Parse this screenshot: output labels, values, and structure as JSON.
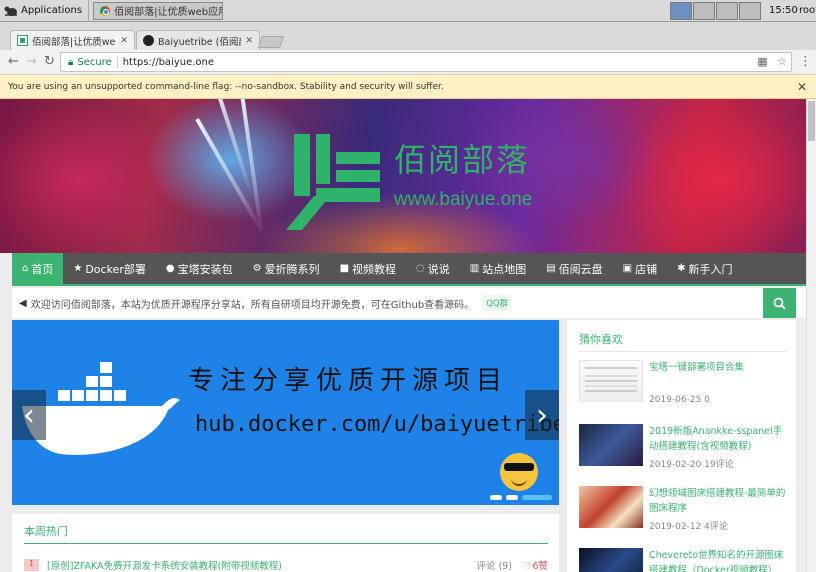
{
  "taskbar": {
    "apps_label": "Applications",
    "task_label": "佰阅部落|让优质web应用脱…",
    "clock": "15:50",
    "user": "root"
  },
  "browser": {
    "tabs": [
      {
        "title": "佰阅部落|让优质web应用脱…",
        "active": true
      },
      {
        "title": "Baiyuetribe (佰阅部落)",
        "active": false
      }
    ],
    "secure_label": "Secure",
    "url": "https://baiyue.one",
    "infobar": "You are using an unsupported command-line flag: --no-sandbox. Stability and security will suffer."
  },
  "site": {
    "logo_title": "佰阅部落",
    "logo_sub": "www.baiyue.one",
    "nav": [
      {
        "label": "首页",
        "icon": "home-icon",
        "glyph": "⌂",
        "active": true
      },
      {
        "label": "Docker部署",
        "icon": "star-icon",
        "glyph": "★",
        "active": false
      },
      {
        "label": "宝塔安装包",
        "icon": "comment-icon",
        "glyph": "●",
        "active": false
      },
      {
        "label": "爱折腾系列",
        "icon": "cogs-icon",
        "glyph": "⚙",
        "active": false
      },
      {
        "label": "视频教程",
        "icon": "video-icon",
        "glyph": "■",
        "active": false
      },
      {
        "label": "说说",
        "icon": "chat-icon",
        "glyph": "◌",
        "active": false
      },
      {
        "label": "站点地图",
        "icon": "map-icon",
        "glyph": "▥",
        "active": false
      },
      {
        "label": "佰阅云盘",
        "icon": "briefcase-icon",
        "glyph": "▤",
        "active": false
      },
      {
        "label": "店铺",
        "icon": "shop-icon",
        "glyph": "▣",
        "active": false
      },
      {
        "label": "新手入门",
        "icon": "gear-icon",
        "glyph": "✱",
        "active": false
      }
    ],
    "notice": "欢迎访问佰阅部落，本站为优质开源程序分享站，所有自研项目均开源免费，可在Github查看源码。",
    "qq_label": "QQ群",
    "slider": {
      "line1": "专注分享优质开源项目",
      "line2": "hub.docker.com/u/baiyuetribe"
    },
    "hot": {
      "title": "本周热门",
      "rows": [
        {
          "rank": "1",
          "title": "[原创]ZFAKA免费开源发卡系统安装教程(附带视频教程)",
          "comments": "评论 (9)",
          "likes": "♡6赞"
        }
      ]
    },
    "sidebar": {
      "title": "猜你喜欢",
      "posts": [
        {
          "title": "宝塔一键部署项目合集",
          "meta": "2019-06-25   0"
        },
        {
          "title": "2019新版Anankke-sspanel手动搭建教程(含视频教程)",
          "meta": "2019-02-20   19评论"
        },
        {
          "title": "幻想领域图床搭建教程-最简单的图床程序",
          "meta": "2019-02-12   4评论"
        },
        {
          "title": "Chevereto世界知名的开源图床搭建教程（Docker视频教程）",
          "meta": ""
        }
      ]
    }
  },
  "colors": {
    "accent": "#3cb371",
    "slider_bg": "#1e83e8",
    "nav_bg": "#555555"
  }
}
